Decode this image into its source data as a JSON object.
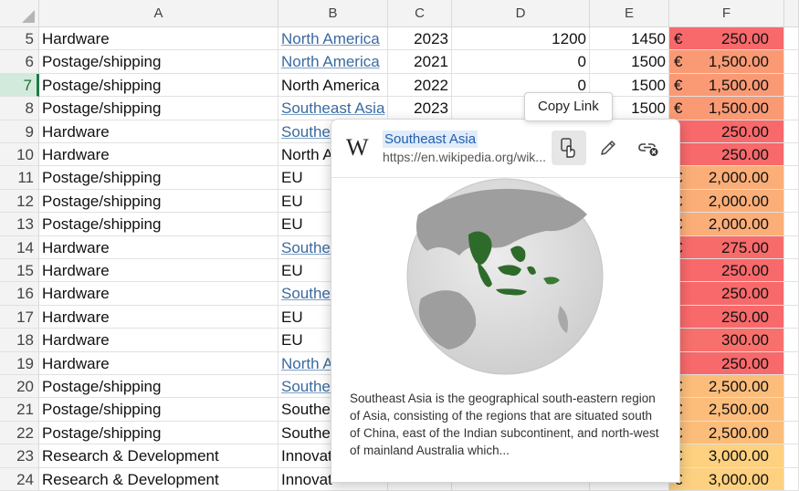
{
  "columns": [
    "A",
    "B",
    "C",
    "D",
    "E",
    "F"
  ],
  "rows": [
    {
      "n": "5",
      "a": "Hardware",
      "b": "North America",
      "b_link": true,
      "c": "2023",
      "d": "1200",
      "e": "1450",
      "cur": "€",
      "f": "250.00",
      "color": "#f8696b"
    },
    {
      "n": "6",
      "a": "Postage/shipping",
      "b": "North America",
      "b_link": true,
      "c": "2021",
      "d": "0",
      "e": "1500",
      "cur": "€",
      "f": "1,500.00",
      "color": "#fa9a75"
    },
    {
      "n": "7",
      "a": "Postage/shipping",
      "b": "North America",
      "b_link": false,
      "c": "2022",
      "d": "0",
      "e": "1500",
      "cur": "€",
      "f": "1,500.00",
      "color": "#fa9a75"
    },
    {
      "n": "8",
      "a": "Postage/shipping",
      "b": "Southeast Asia",
      "b_link": true,
      "c": "2023",
      "d": "",
      "e": "1500",
      "cur": "€",
      "f": "1,500.00",
      "color": "#fa9a75"
    },
    {
      "n": "9",
      "a": "Hardware",
      "b": "Southe",
      "b_link": true,
      "c": "",
      "d": "",
      "e": "",
      "cur": "",
      "f": "250.00",
      "color": "#f8696b"
    },
    {
      "n": "10",
      "a": "Hardware",
      "b": "North A",
      "b_link": false,
      "c": "",
      "d": "",
      "e": "",
      "cur": "",
      "f": "250.00",
      "color": "#f8696b"
    },
    {
      "n": "11",
      "a": "Postage/shipping",
      "b": "EU",
      "b_link": false,
      "c": "",
      "d": "",
      "e": "",
      "cur": "€",
      "f": "2,000.00",
      "color": "#fbae78"
    },
    {
      "n": "12",
      "a": "Postage/shipping",
      "b": "EU",
      "b_link": false,
      "c": "",
      "d": "",
      "e": "",
      "cur": "€",
      "f": "2,000.00",
      "color": "#fbae78"
    },
    {
      "n": "13",
      "a": "Postage/shipping",
      "b": "EU",
      "b_link": false,
      "c": "",
      "d": "",
      "e": "",
      "cur": "€",
      "f": "2,000.00",
      "color": "#fbae78"
    },
    {
      "n": "14",
      "a": "Hardware",
      "b": "Southe",
      "b_link": true,
      "c": "",
      "d": "",
      "e": "",
      "cur": "€",
      "f": "275.00",
      "color": "#f86b6b"
    },
    {
      "n": "15",
      "a": "Hardware",
      "b": "EU",
      "b_link": false,
      "c": "",
      "d": "",
      "e": "",
      "cur": "",
      "f": "250.00",
      "color": "#f8696b"
    },
    {
      "n": "16",
      "a": "Hardware",
      "b": "Southe",
      "b_link": true,
      "c": "",
      "d": "",
      "e": "",
      "cur": "",
      "f": "250.00",
      "color": "#f8696b"
    },
    {
      "n": "17",
      "a": "Hardware",
      "b": "EU",
      "b_link": false,
      "c": "",
      "d": "",
      "e": "",
      "cur": "",
      "f": "250.00",
      "color": "#f8696b"
    },
    {
      "n": "18",
      "a": "Hardware",
      "b": "EU",
      "b_link": false,
      "c": "",
      "d": "",
      "e": "",
      "cur": "",
      "f": "300.00",
      "color": "#f8706c"
    },
    {
      "n": "19",
      "a": "Hardware",
      "b": "North A",
      "b_link": true,
      "c": "",
      "d": "",
      "e": "",
      "cur": "",
      "f": "250.00",
      "color": "#f8696b"
    },
    {
      "n": "20",
      "a": "Postage/shipping",
      "b": "Southe",
      "b_link": true,
      "c": "",
      "d": "",
      "e": "",
      "cur": "€",
      "f": "2,500.00",
      "color": "#fcbd7b"
    },
    {
      "n": "21",
      "a": "Postage/shipping",
      "b": "Southe",
      "b_link": false,
      "c": "",
      "d": "",
      "e": "",
      "cur": "€",
      "f": "2,500.00",
      "color": "#fcbd7b"
    },
    {
      "n": "22",
      "a": "Postage/shipping",
      "b": "Southe",
      "b_link": false,
      "c": "",
      "d": "",
      "e": "",
      "cur": "€",
      "f": "2,500.00",
      "color": "#fcbd7b"
    },
    {
      "n": "23",
      "a": "Research & Development",
      "b": "Innovat",
      "b_link": false,
      "c": "",
      "d": "",
      "e": "",
      "cur": "€",
      "f": "3,000.00",
      "color": "#fdd17f"
    },
    {
      "n": "24",
      "a": "Research & Development",
      "b": "Innovat",
      "b_link": false,
      "c": "",
      "d": "",
      "e": "",
      "cur": "€",
      "f": "3,000.00",
      "color": "#fdd17f"
    }
  ],
  "active_row": "7",
  "popup": {
    "logo": "W",
    "title": "Southeast Asia",
    "url": "https://en.wikipedia.org/wik...",
    "description": "Southeast Asia is the geographical south-eastern region of Asia, consisting of the regions that are situated south of China, east of the Indian subcontinent, and north-west of mainland Australia which...",
    "copy_icon": "copy-link-icon",
    "edit_icon": "pencil-icon",
    "remove_icon": "unlink-icon"
  },
  "tooltip": "Copy Link",
  "colors": {
    "link": "#3b6aa0",
    "header_bg": "#f3f3f3",
    "active_row": "#d2eadc",
    "region_green": "#2e7d32"
  }
}
